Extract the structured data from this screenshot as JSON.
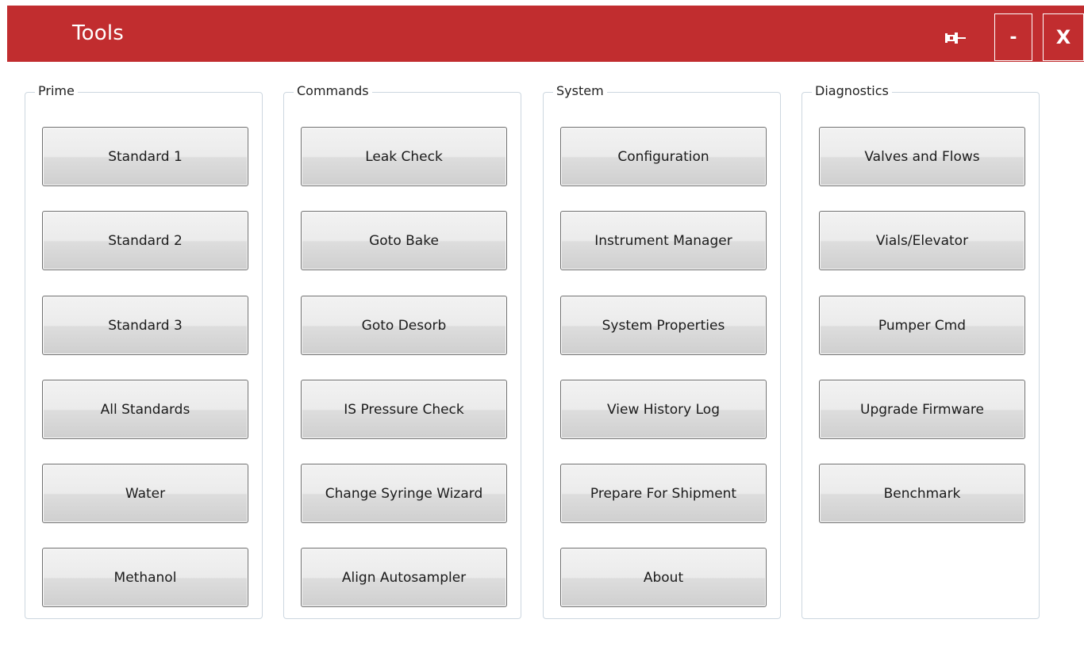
{
  "window": {
    "title": "Tools",
    "minimize_label": "-",
    "close_label": "X",
    "accent": "#c12d2f"
  },
  "groups": [
    {
      "label": "Prime",
      "buttons": [
        "Standard 1",
        "Standard 2",
        "Standard 3",
        "All Standards",
        "Water",
        "Methanol"
      ]
    },
    {
      "label": "Commands",
      "buttons": [
        "Leak Check",
        "Goto Bake",
        "Goto Desorb",
        "IS Pressure Check",
        "Change Syringe Wizard",
        "Align Autosampler"
      ]
    },
    {
      "label": "System",
      "buttons": [
        "Configuration",
        "Instrument Manager",
        "System Properties",
        "View History Log",
        "Prepare For Shipment",
        "About"
      ]
    },
    {
      "label": "Diagnostics",
      "buttons": [
        "Valves and Flows",
        "Vials/Elevator",
        "Pumper Cmd",
        "Upgrade Firmware",
        "Benchmark"
      ]
    }
  ],
  "icons": {
    "pin": "pin-icon"
  }
}
